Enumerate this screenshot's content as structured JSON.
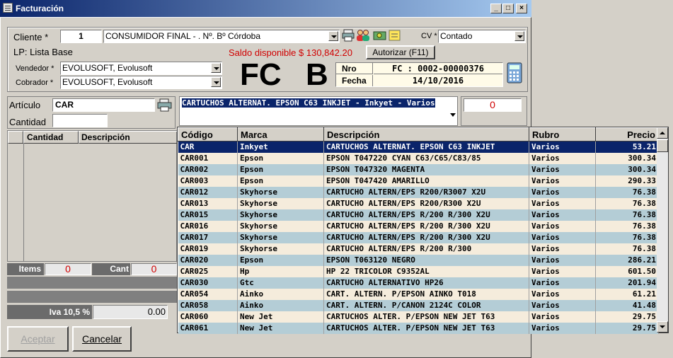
{
  "window": {
    "title": "Facturación"
  },
  "header": {
    "cliente_label": "Cliente *",
    "cliente_code": "1",
    "cliente_name": "CONSUMIDOR FINAL - . Nº. Bº Córdoba",
    "cv_label": "CV *",
    "cv_value": "Contado",
    "lp_text": "LP: Lista Base",
    "saldo_text": "Saldo disponible $ 130,842.20",
    "autorizar_label": "Autorizar (F11)",
    "vendedor_label": "Vendedor *",
    "vendedor_value": "EVOLUSOFT, Evolusoft",
    "cobrador_label": "Cobrador *",
    "cobrador_value": "EVOLUSOFT, Evolusoft",
    "doc_type": "FC",
    "doc_letter": "B",
    "nro_label": "Nro",
    "nro_value": "FC : 0002-00000376",
    "fecha_label": "Fecha",
    "fecha_value": "14/10/2016"
  },
  "article": {
    "articulo_label": "Artículo",
    "articulo_value": "CAR",
    "cantidad_label": "Cantidad",
    "cantidad_value": "",
    "description": "CARTUCHOS ALTERNAT. EPSON C63 INKJET - Inkyet - Varios",
    "amount": "0"
  },
  "items_grid": {
    "col_cantidad": "Cantidad",
    "col_descripcion": "Descripción"
  },
  "totals": {
    "items_label": "Items",
    "items_value": "0",
    "cant_label": "Cant",
    "cant_value": "0",
    "iva_label": "Iva 10,5 %",
    "iva_value": "0.00"
  },
  "buttons": {
    "aceptar": "Aceptar",
    "cancelar": "Cancelar"
  },
  "lookup": {
    "columns": [
      "Código",
      "Marca",
      "Descripción",
      "Rubro",
      "Precio"
    ],
    "rows": [
      [
        "CAR",
        "Inkyet",
        "CARTUCHOS ALTERNAT. EPSON C63 INKJET",
        "Varios",
        "53.21"
      ],
      [
        "CAR001",
        "Epson",
        "EPSON  T047220 CYAN C63/C65/C83/85",
        "Varios",
        "300.34"
      ],
      [
        "CAR002",
        "Epson",
        "EPSON  T047320 MAGENTA",
        "Varios",
        "300.34"
      ],
      [
        "CAR003",
        "Epson",
        "EPSON  T047420 AMARILLO",
        "Varios",
        "290.33"
      ],
      [
        "CAR012",
        "Skyhorse",
        "CARTUCHO ALTERN/EPS R200/R3007 X2U",
        "Varios",
        "76.38"
      ],
      [
        "CAR013",
        "Skyhorse",
        "CARTUCHO ALTERN/EPS R200/R300 X2U",
        "Varios",
        "76.38"
      ],
      [
        "CAR015",
        "Skyhorse",
        "CARTUCHO ALTERN/EPS R/200 R/300 X2U",
        "Varios",
        "76.38"
      ],
      [
        "CAR016",
        "Skyhorse",
        "CARTUCHO ALTERN/EPS R/200 R/300 X2U",
        "Varios",
        "76.38"
      ],
      [
        "CAR017",
        "Skyhorse",
        "CARTUCHO ALTERN/EPS R/200 R/300 X2U",
        "Varios",
        "76.38"
      ],
      [
        "CAR019",
        "Skyhorse",
        "CARTUCHO ALTERN/EPS R/200 R/300",
        "Varios",
        "76.38"
      ],
      [
        "CAR020",
        "Epson",
        "EPSON  T063120 NEGRO",
        "Varios",
        "286.21"
      ],
      [
        "CAR025",
        "Hp",
        "HP  22 TRICOLOR C9352AL",
        "Varios",
        "601.50"
      ],
      [
        "CAR030",
        "Gtc",
        "CARTUCHO ALTERNATIVO HP26",
        "Varios",
        "201.94"
      ],
      [
        "CAR054",
        "Ainko",
        "CART. ALTERN. P/EPSON AINKO T018",
        "Varios",
        "61.21"
      ],
      [
        "CAR058",
        "Ainko",
        "CART. ALTERN. P/CANON 2124C COLOR",
        "Varios",
        "41.48"
      ],
      [
        "CAR060",
        "New Jet",
        "CARTUCHOS ALTER. P/EPSON NEW JET T63",
        "Varios",
        "29.75"
      ],
      [
        "CAR061",
        "New Jet",
        "CARTUCHOS ALTER. P/EPSON NEW JET T63",
        "Varios",
        "29.75"
      ]
    ]
  },
  "colors": {
    "title_bar": "#0a246a",
    "selection": "#0a246a",
    "row_odd": "#f5ecdc",
    "row_even": "#b4cdd6",
    "red": "#d00000"
  },
  "icons": [
    "printer-icon",
    "people-icon",
    "money-icon",
    "note-icon",
    "calculator-icon"
  ]
}
